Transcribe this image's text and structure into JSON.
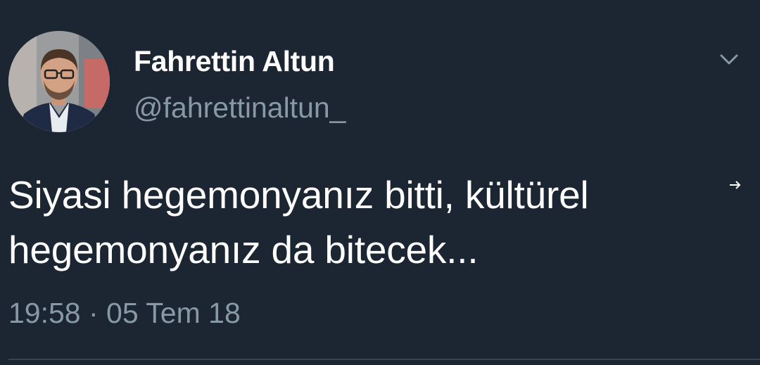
{
  "tweet": {
    "author": {
      "display_name": "Fahrettin Altun",
      "handle": "@fahrettinaltun_",
      "avatar_icon": "profile-photo"
    },
    "text_lines": [
      "Siyasi hegemonyanız bitti, kültürel",
      "hegemonyanız da bitecek..."
    ],
    "timestamp": "19:58 · 05 Tem 18",
    "menu_icon": "chevron-down-icon",
    "translation_icon": "arrow-right-icon"
  },
  "colors": {
    "background": "#1c2532",
    "primary_text": "#ffffff",
    "secondary_text": "#8899a6",
    "divider": "#38444d"
  }
}
